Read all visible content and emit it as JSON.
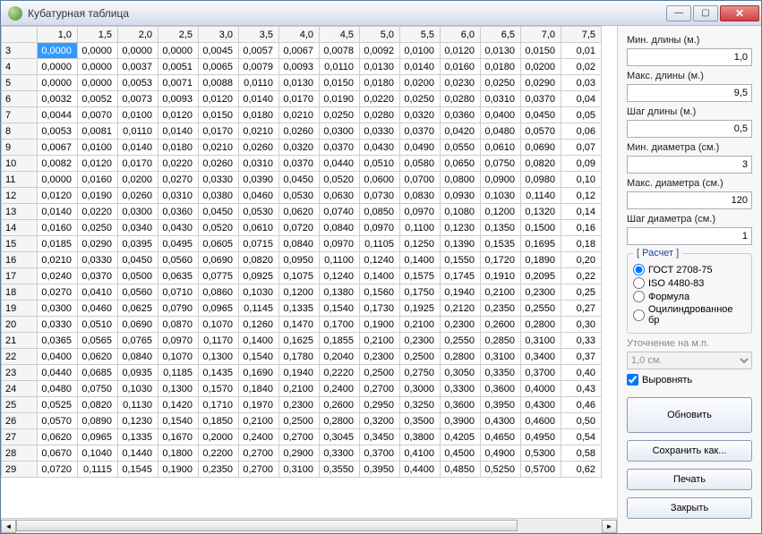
{
  "window": {
    "title": "Кубатурная таблица"
  },
  "side": {
    "min_len_label": "Мин. длины (м.)",
    "min_len": "1,0",
    "max_len_label": "Макс. длины (м.)",
    "max_len": "9,5",
    "step_len_label": "Шаг длины (м.)",
    "step_len": "0,5",
    "min_dia_label": "Мин. диаметра (см.)",
    "min_dia": "3",
    "max_dia_label": "Макс. диаметра (см.)",
    "max_dia": "120",
    "step_dia_label": "Шаг диаметра (см.)",
    "step_dia": "1",
    "calc_legend": "[ Расчет ]",
    "radios": [
      "ГОСТ 2708-75",
      "ISO 4480-83",
      "Формула",
      "Оцилиндрованное бр"
    ],
    "refine_label": "Уточнение на м.п.",
    "refine_value": "1,0 см.",
    "align_label": "Выровнять",
    "btn_update": "Обновить",
    "btn_save": "Сохранить как...",
    "btn_print": "Печать",
    "btn_close": "Закрыть"
  },
  "grid": {
    "col_headers": [
      "1,0",
      "1,5",
      "2,0",
      "2,5",
      "3,0",
      "3,5",
      "4,0",
      "4,5",
      "5,0",
      "5,5",
      "6,0",
      "6,5",
      "7,0",
      "7,5"
    ],
    "row_headers": [
      "3",
      "4",
      "5",
      "6",
      "7",
      "8",
      "9",
      "10",
      "11",
      "12",
      "13",
      "14",
      "15",
      "16",
      "17",
      "18",
      "19",
      "20",
      "21",
      "22",
      "23",
      "24",
      "25",
      "26",
      "27",
      "28",
      "29"
    ],
    "rows": [
      [
        "0,0000",
        "0,0000",
        "0,0000",
        "0,0000",
        "0,0045",
        "0,0057",
        "0,0067",
        "0,0078",
        "0,0092",
        "0,0100",
        "0,0120",
        "0,0130",
        "0,0150",
        "0,01"
      ],
      [
        "0,0000",
        "0,0000",
        "0,0037",
        "0,0051",
        "0,0065",
        "0,0079",
        "0,0093",
        "0,0110",
        "0,0130",
        "0,0140",
        "0,0160",
        "0,0180",
        "0,0200",
        "0,02"
      ],
      [
        "0,0000",
        "0,0000",
        "0,0053",
        "0,0071",
        "0,0088",
        "0,0110",
        "0,0130",
        "0,0150",
        "0,0180",
        "0,0200",
        "0,0230",
        "0,0250",
        "0,0290",
        "0,03"
      ],
      [
        "0,0032",
        "0,0052",
        "0,0073",
        "0,0093",
        "0,0120",
        "0,0140",
        "0,0170",
        "0,0190",
        "0,0220",
        "0,0250",
        "0,0280",
        "0,0310",
        "0,0370",
        "0,04"
      ],
      [
        "0,0044",
        "0,0070",
        "0,0100",
        "0,0120",
        "0,0150",
        "0,0180",
        "0,0210",
        "0,0250",
        "0,0280",
        "0,0320",
        "0,0360",
        "0,0400",
        "0,0450",
        "0,05"
      ],
      [
        "0,0053",
        "0,0081",
        "0,0110",
        "0,0140",
        "0,0170",
        "0,0210",
        "0,0260",
        "0,0300",
        "0,0330",
        "0,0370",
        "0,0420",
        "0,0480",
        "0,0570",
        "0,06"
      ],
      [
        "0,0067",
        "0,0100",
        "0,0140",
        "0,0180",
        "0,0210",
        "0,0260",
        "0,0320",
        "0,0370",
        "0,0430",
        "0,0490",
        "0,0550",
        "0,0610",
        "0,0690",
        "0,07"
      ],
      [
        "0,0082",
        "0,0120",
        "0,0170",
        "0,0220",
        "0,0260",
        "0,0310",
        "0,0370",
        "0,0440",
        "0,0510",
        "0,0580",
        "0,0650",
        "0,0750",
        "0,0820",
        "0,09"
      ],
      [
        "0,0000",
        "0,0160",
        "0,0200",
        "0,0270",
        "0,0330",
        "0,0390",
        "0,0450",
        "0,0520",
        "0,0600",
        "0,0700",
        "0,0800",
        "0,0900",
        "0,0980",
        "0,10"
      ],
      [
        "0,0120",
        "0,0190",
        "0,0260",
        "0,0310",
        "0,0380",
        "0,0460",
        "0,0530",
        "0,0630",
        "0,0730",
        "0,0830",
        "0,0930",
        "0,1030",
        "0,1140",
        "0,12"
      ],
      [
        "0,0140",
        "0,0220",
        "0,0300",
        "0,0360",
        "0,0450",
        "0,0530",
        "0,0620",
        "0,0740",
        "0,0850",
        "0,0970",
        "0,1080",
        "0,1200",
        "0,1320",
        "0,14"
      ],
      [
        "0,0160",
        "0,0250",
        "0,0340",
        "0,0430",
        "0,0520",
        "0,0610",
        "0,0720",
        "0,0840",
        "0,0970",
        "0,1100",
        "0,1230",
        "0,1350",
        "0,1500",
        "0,16"
      ],
      [
        "0,0185",
        "0,0290",
        "0,0395",
        "0,0495",
        "0,0605",
        "0,0715",
        "0,0840",
        "0,0970",
        "0,1105",
        "0,1250",
        "0,1390",
        "0,1535",
        "0,1695",
        "0,18"
      ],
      [
        "0,0210",
        "0,0330",
        "0,0450",
        "0,0560",
        "0,0690",
        "0,0820",
        "0,0950",
        "0,1100",
        "0,1240",
        "0,1400",
        "0,1550",
        "0,1720",
        "0,1890",
        "0,20"
      ],
      [
        "0,0240",
        "0,0370",
        "0,0500",
        "0,0635",
        "0,0775",
        "0,0925",
        "0,1075",
        "0,1240",
        "0,1400",
        "0,1575",
        "0,1745",
        "0,1910",
        "0,2095",
        "0,22"
      ],
      [
        "0,0270",
        "0,0410",
        "0,0560",
        "0,0710",
        "0,0860",
        "0,1030",
        "0,1200",
        "0,1380",
        "0,1560",
        "0,1750",
        "0,1940",
        "0,2100",
        "0,2300",
        "0,25"
      ],
      [
        "0,0300",
        "0,0460",
        "0,0625",
        "0,0790",
        "0,0965",
        "0,1145",
        "0,1335",
        "0,1540",
        "0,1730",
        "0,1925",
        "0,2120",
        "0,2350",
        "0,2550",
        "0,27"
      ],
      [
        "0,0330",
        "0,0510",
        "0,0690",
        "0,0870",
        "0,1070",
        "0,1260",
        "0,1470",
        "0,1700",
        "0,1900",
        "0,2100",
        "0,2300",
        "0,2600",
        "0,2800",
        "0,30"
      ],
      [
        "0,0365",
        "0,0565",
        "0,0765",
        "0,0970",
        "0,1170",
        "0,1400",
        "0,1625",
        "0,1855",
        "0,2100",
        "0,2300",
        "0,2550",
        "0,2850",
        "0,3100",
        "0,33"
      ],
      [
        "0,0400",
        "0,0620",
        "0,0840",
        "0,1070",
        "0,1300",
        "0,1540",
        "0,1780",
        "0,2040",
        "0,2300",
        "0,2500",
        "0,2800",
        "0,3100",
        "0,3400",
        "0,37"
      ],
      [
        "0,0440",
        "0,0685",
        "0,0935",
        "0,1185",
        "0,1435",
        "0,1690",
        "0,1940",
        "0,2220",
        "0,2500",
        "0,2750",
        "0,3050",
        "0,3350",
        "0,3700",
        "0,40"
      ],
      [
        "0,0480",
        "0,0750",
        "0,1030",
        "0,1300",
        "0,1570",
        "0,1840",
        "0,2100",
        "0,2400",
        "0,2700",
        "0,3000",
        "0,3300",
        "0,3600",
        "0,4000",
        "0,43"
      ],
      [
        "0,0525",
        "0,0820",
        "0,1130",
        "0,1420",
        "0,1710",
        "0,1970",
        "0,2300",
        "0,2600",
        "0,2950",
        "0,3250",
        "0,3600",
        "0,3950",
        "0,4300",
        "0,46"
      ],
      [
        "0,0570",
        "0,0890",
        "0,1230",
        "0,1540",
        "0,1850",
        "0,2100",
        "0,2500",
        "0,2800",
        "0,3200",
        "0,3500",
        "0,3900",
        "0,4300",
        "0,4600",
        "0,50"
      ],
      [
        "0,0620",
        "0,0965",
        "0,1335",
        "0,1670",
        "0,2000",
        "0,2400",
        "0,2700",
        "0,3045",
        "0,3450",
        "0,3800",
        "0,4205",
        "0,4650",
        "0,4950",
        "0,54"
      ],
      [
        "0,0670",
        "0,1040",
        "0,1440",
        "0,1800",
        "0,2200",
        "0,2700",
        "0,2900",
        "0,3300",
        "0,3700",
        "0,4100",
        "0,4500",
        "0,4900",
        "0,5300",
        "0,58"
      ],
      [
        "0,0720",
        "0,1115",
        "0,1545",
        "0,1900",
        "0,2350",
        "0,2700",
        "0,3100",
        "0,3550",
        "0,3950",
        "0,4400",
        "0,4850",
        "0,5250",
        "0,5700",
        "0,62"
      ]
    ],
    "selected": {
      "row": 0,
      "col": 0
    }
  }
}
